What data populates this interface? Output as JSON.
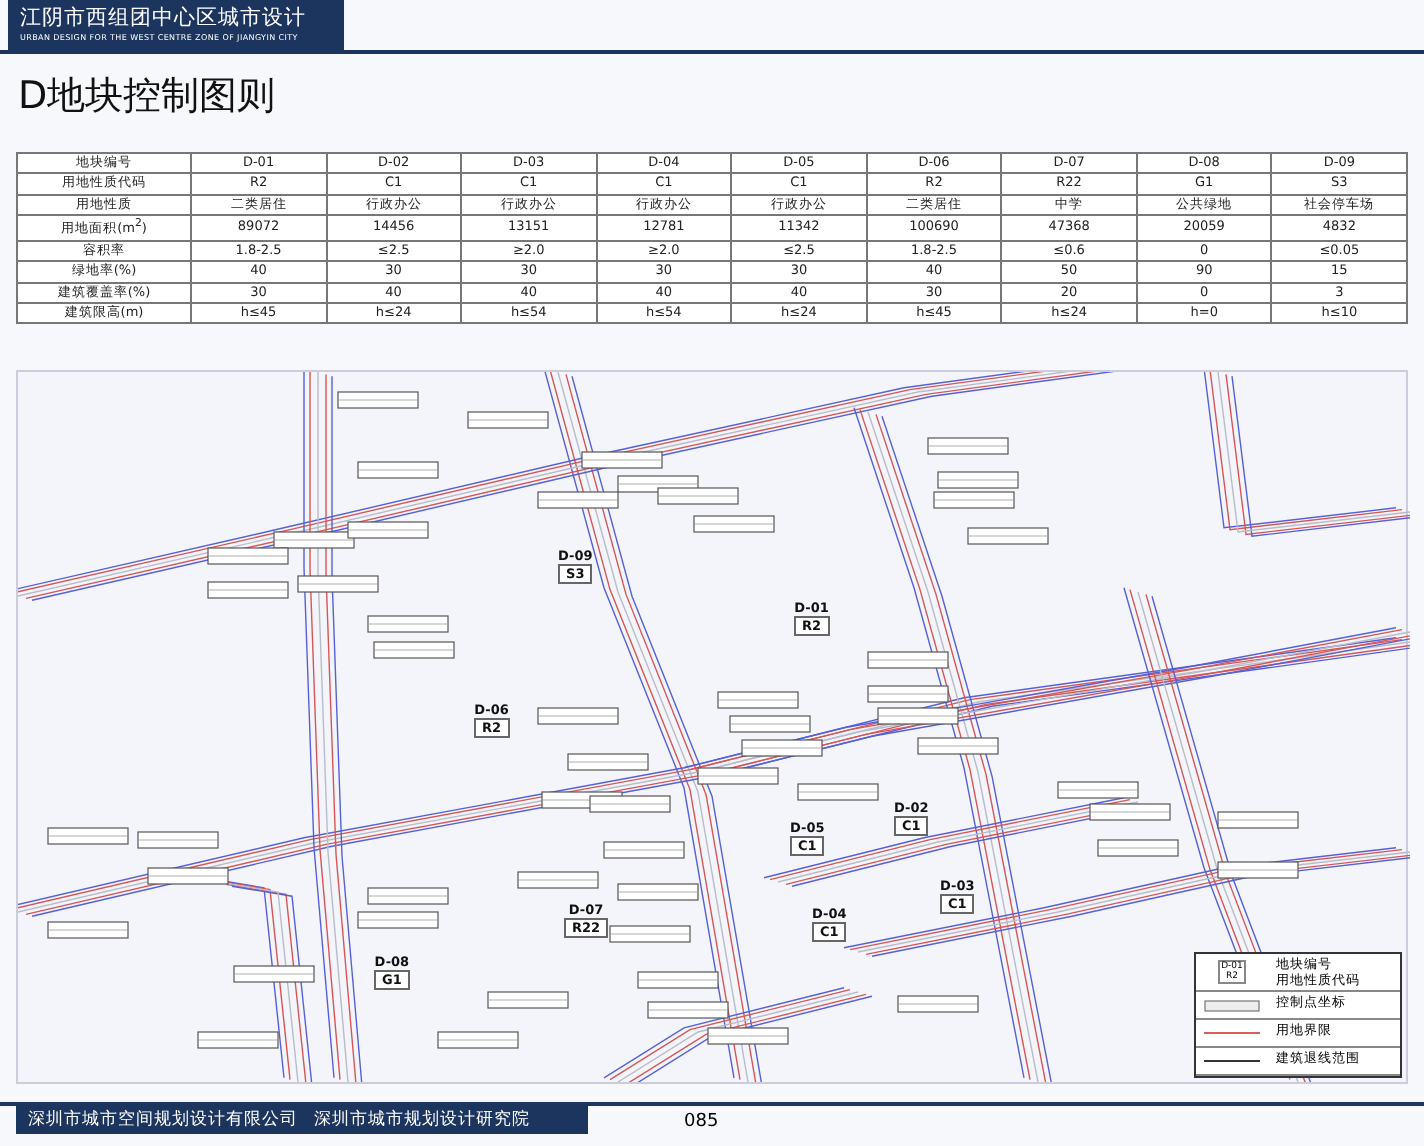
{
  "header": {
    "title": "江阴市西组团中心区城市设计",
    "subtitle": "URBAN DESIGN FOR THE WEST CENTRE ZONE OF JIANGYIN CITY"
  },
  "page_title": "D地块控制图则",
  "table": {
    "rows": [
      {
        "label": "地块编号",
        "cells": [
          "D-01",
          "D-02",
          "D-03",
          "D-04",
          "D-05",
          "D-06",
          "D-07",
          "D-08",
          "D-09"
        ]
      },
      {
        "label": "用地性质代码",
        "cells": [
          "R2",
          "C1",
          "C1",
          "C1",
          "C1",
          "R2",
          "R22",
          "G1",
          "S3"
        ]
      },
      {
        "label": "用地性质",
        "cells": [
          "二类居住",
          "行政办公",
          "行政办公",
          "行政办公",
          "行政办公",
          "二类居住",
          "中学",
          "公共绿地",
          "社会停车场"
        ]
      },
      {
        "label": "用地面积(m$^{2}$)",
        "cells": [
          "89072",
          "14456",
          "13151",
          "12781",
          "11342",
          "100690",
          "47368",
          "20059",
          "4832"
        ]
      },
      {
        "label": "容积率",
        "cells": [
          "1.8-2.5",
          "≤2.5",
          "≥2.0",
          "≥2.0",
          "≤2.5",
          "1.8-2.5",
          "≤0.6",
          "0",
          "≤0.05"
        ]
      },
      {
        "label": "绿地率(%)",
        "cells": [
          "40",
          "30",
          "30",
          "30",
          "30",
          "40",
          "50",
          "90",
          "15"
        ]
      },
      {
        "label": "建筑覆盖率(%)",
        "cells": [
          "30",
          "40",
          "40",
          "40",
          "40",
          "30",
          "20",
          "0",
          "3"
        ]
      },
      {
        "label": "建筑限高(m)",
        "cells": [
          "h≤45",
          "h≤24",
          "h≤54",
          "h≤54",
          "h≤24",
          "h≤45",
          "h≤24",
          "h=0",
          "h≤10"
        ]
      }
    ]
  },
  "map": {
    "plots": [
      {
        "code": "D-09",
        "use": "S3"
      },
      {
        "code": "D-01",
        "use": "R2"
      },
      {
        "code": "D-06",
        "use": "R2"
      },
      {
        "code": "D-02",
        "use": "C1"
      },
      {
        "code": "D-05",
        "use": "C1"
      },
      {
        "code": "D-03",
        "use": "C1"
      },
      {
        "code": "D-04",
        "use": "C1"
      },
      {
        "code": "D-07",
        "use": "R22"
      },
      {
        "code": "D-08",
        "use": "G1"
      }
    ]
  },
  "legend": [
    {
      "kind": "plot-label",
      "sample_code": "D-01",
      "sample_use": "R2",
      "labels": [
        "地块编号",
        "用地性质代码"
      ]
    },
    {
      "kind": "control-point",
      "labels": [
        "控制点坐标"
      ]
    },
    {
      "kind": "red-line",
      "labels": [
        "用地界限"
      ]
    },
    {
      "kind": "black-line",
      "labels": [
        "建筑退线范围"
      ]
    }
  ],
  "footer": {
    "organizations": [
      "深圳市城市空间规划设计有限公司",
      "深圳市城市规划设计研究院"
    ],
    "page_number": "085"
  }
}
